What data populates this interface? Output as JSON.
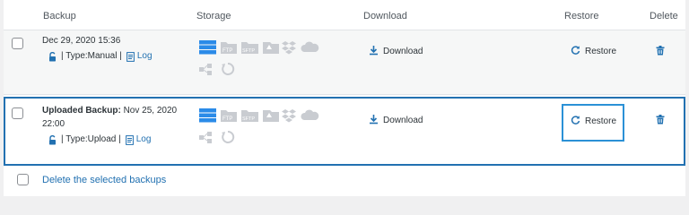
{
  "columns": {
    "backup": "Backup",
    "storage": "Storage",
    "download": "Download",
    "restore": "Restore",
    "delete": "Delete"
  },
  "rows": [
    {
      "prefix": "",
      "date": "Dec 29, 2020 15:36",
      "type_label": "| Type:Manual |",
      "log_label": "Log",
      "storage_icons": [
        "server-icon",
        "ftp-icon",
        "sftp-icon",
        "google-drive-icon",
        "dropbox-icon",
        "cloud-icon",
        "network-icon",
        "sync-icon"
      ],
      "ftp_text": "FTP",
      "sftp_text": "SFTP",
      "download_label": "Download",
      "restore_label": "Restore"
    },
    {
      "prefix": "Uploaded Backup:",
      "date_line1": "Nov 25, 2020",
      "date_line2": "22:00",
      "type_label": "| Type:Upload |",
      "log_label": "Log",
      "storage_icons": [
        "server-icon",
        "ftp-icon",
        "sftp-icon",
        "google-drive-icon",
        "dropbox-icon",
        "cloud-icon",
        "network-icon",
        "sync-icon"
      ],
      "ftp_text": "FTP",
      "sftp_text": "SFTP",
      "download_label": "Download",
      "restore_label": "Restore"
    }
  ],
  "footer": {
    "delete_selected_label": "Delete the selected backups"
  },
  "colors": {
    "accent": "#2271b1",
    "highlight_border": "#2b91d6",
    "icon_active": "#2b8be8",
    "icon_inactive": "#c9ccd1"
  }
}
